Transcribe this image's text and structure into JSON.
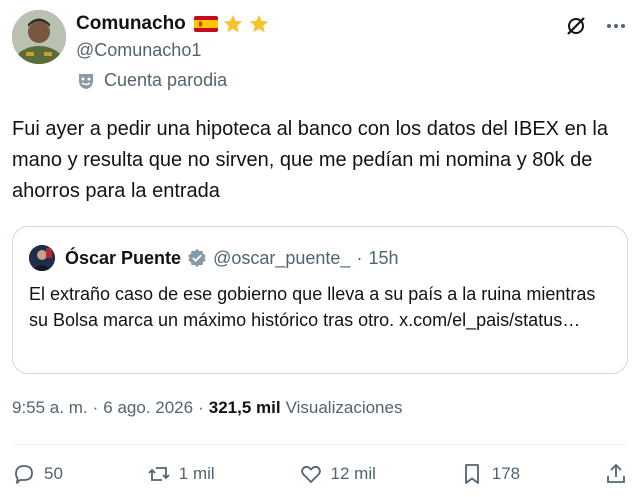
{
  "author": {
    "display_name": "Comunacho",
    "handle": "@Comunacho1",
    "parody_label": "Cuenta parodia",
    "badges": [
      "spain-flag-icon",
      "star-icon",
      "star-icon"
    ]
  },
  "tweet": {
    "text": "Fui ayer a pedir una hipoteca al banco con los datos del IBEX en la mano y resulta que no sirven, que me pedían mi nomina y 80k de ahorros para la entrada"
  },
  "quote": {
    "name": "Óscar Puente",
    "handle": "@oscar_puente_",
    "separator": "·",
    "time": "15h",
    "text": "El extraño caso de ese gobierno que lleva a su país a la ruina mientras su Bolsa marca un máximo histórico tras otro. x.com/el_pais/status…"
  },
  "meta": {
    "time": "9:55 a. m.",
    "separator": "·",
    "date": "6 ago. 2026",
    "views_count": "321,5 mil",
    "views_label": "Visualizaciones"
  },
  "actions": {
    "replies": "50",
    "reposts": "1 mil",
    "likes": "12 mil",
    "bookmarks": "178"
  },
  "colors": {
    "text": "#0f1419",
    "secondary": "#536471",
    "border": "#cfd9de",
    "star": "#f4c430",
    "verified": "#829aab"
  }
}
